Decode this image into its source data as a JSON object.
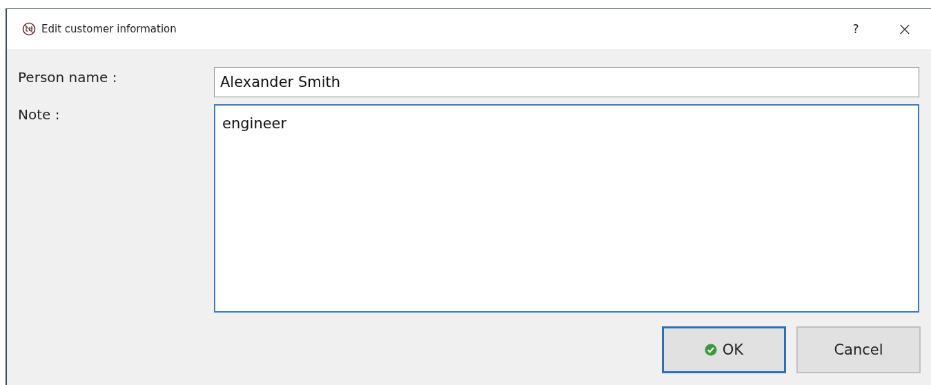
{
  "window": {
    "title": "Edit customer information",
    "help": "?",
    "close": "×"
  },
  "fields": [
    {
      "kind": "line",
      "label": "Person name :",
      "value": "Alexander Smith",
      "focused": false
    },
    {
      "kind": "multiline",
      "label": "Note :",
      "value": "engineer",
      "focused": true
    }
  ],
  "buttons": [
    {
      "kind": "confirm",
      "label": "OK",
      "default": true
    },
    {
      "kind": "plain",
      "label": "Cancel",
      "default": false
    }
  ]
}
